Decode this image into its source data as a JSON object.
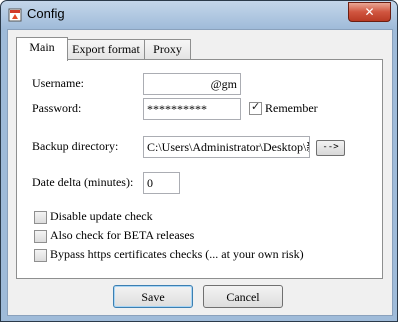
{
  "window": {
    "title": "Config",
    "close_glyph": "✕"
  },
  "tabs": [
    {
      "label": "Main",
      "active": true
    },
    {
      "label": "Export format",
      "active": false
    },
    {
      "label": "Proxy",
      "active": false
    }
  ],
  "main": {
    "username": {
      "label": "Username:",
      "value": "@gm"
    },
    "password": {
      "label": "Password:",
      "value": "**********"
    },
    "remember": {
      "label": "Remember",
      "checked": true
    },
    "backup": {
      "label": "Backup directory:",
      "value": "C:\\Users\\Administrator\\Desktop\\新",
      "browse_label": "-->"
    },
    "date_delta": {
      "label": "Date delta (minutes):",
      "value": "0"
    },
    "options": [
      {
        "label": "Disable update check",
        "checked": false
      },
      {
        "label": "Also check for BETA releases",
        "checked": false
      },
      {
        "label": "Bypass https certificates checks (... at your own risk)",
        "checked": false
      }
    ]
  },
  "buttons": {
    "save": "Save",
    "cancel": "Cancel"
  },
  "check_glyph": "✓",
  "colors": {
    "titlebar": "#9fbbd9",
    "close": "#c8452f",
    "panel": "#ffffff",
    "dialog": "#f0f0f0"
  }
}
